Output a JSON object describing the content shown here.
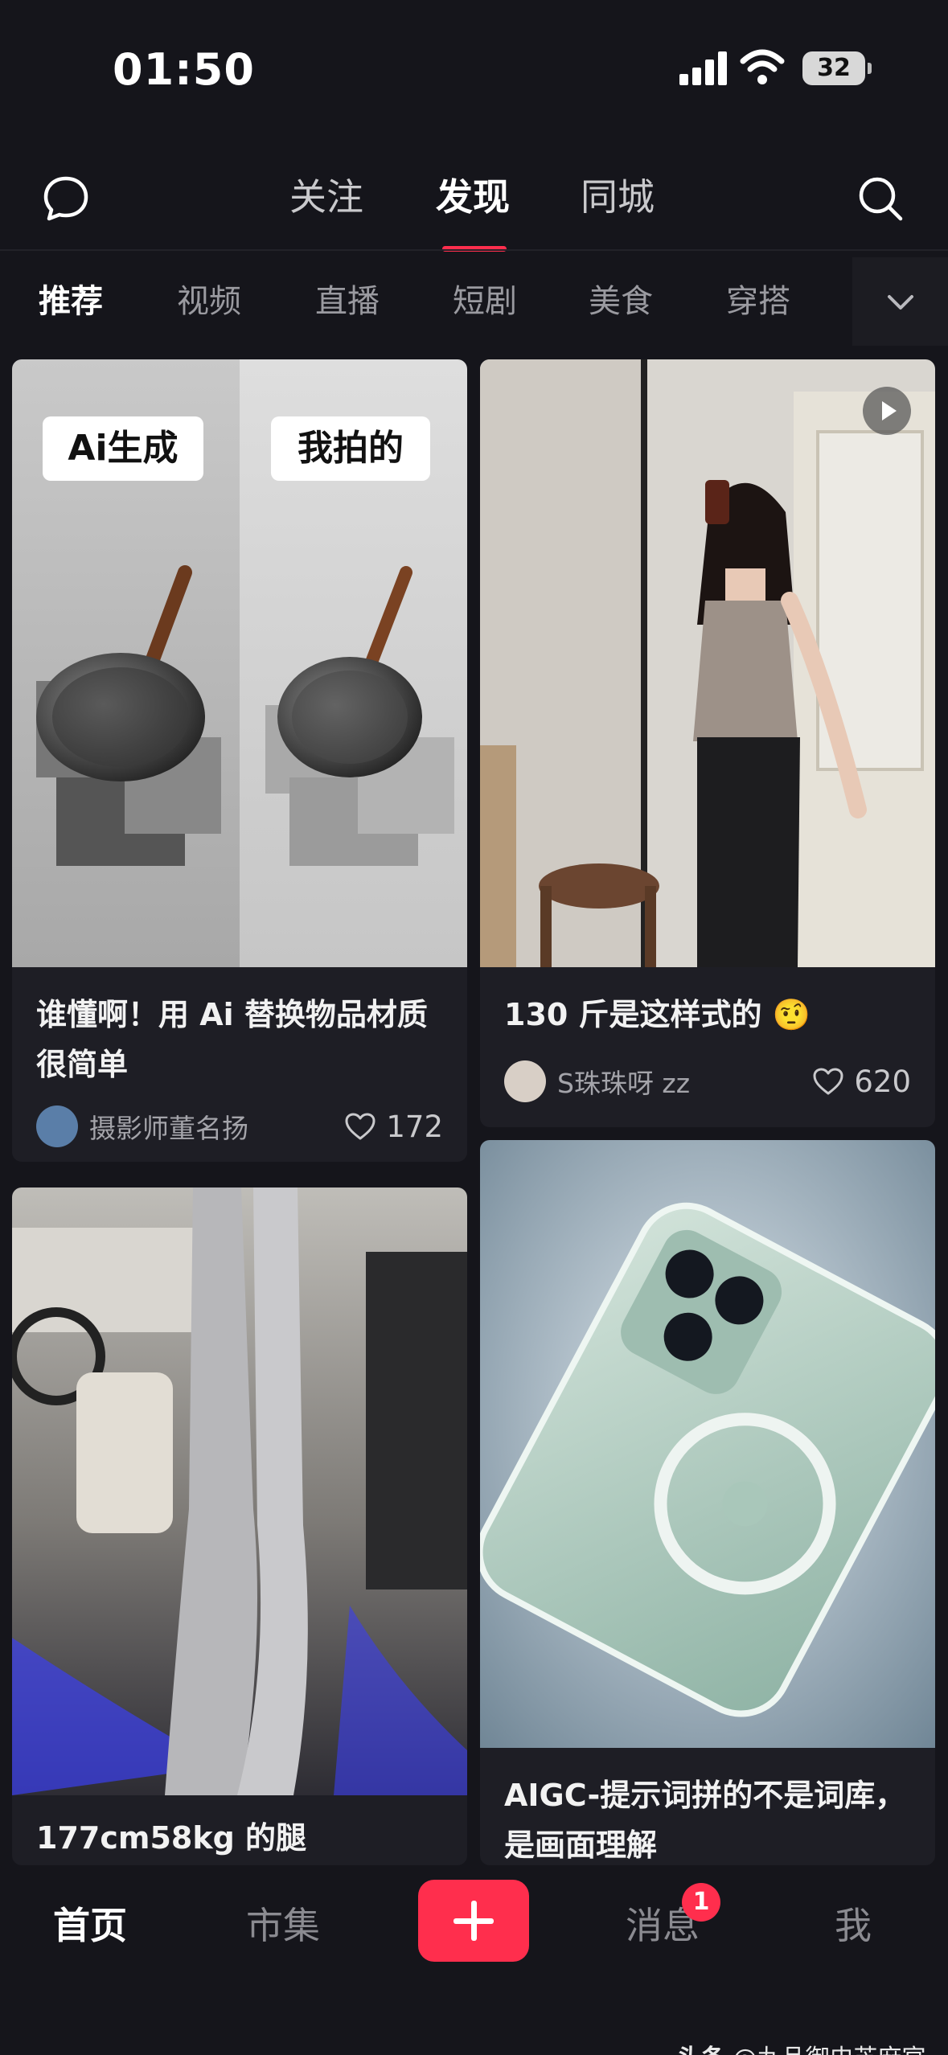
{
  "status_bar": {
    "time": "01:50",
    "battery": "32"
  },
  "top_nav": {
    "tabs": [
      {
        "label": "关注"
      },
      {
        "label": "发现"
      },
      {
        "label": "同城"
      }
    ],
    "active_tab": "发现",
    "accent": "#ff2e4d"
  },
  "categories": [
    "推荐",
    "视频",
    "直播",
    "短剧",
    "美食",
    "穿搭"
  ],
  "feed": [
    {
      "labels": [
        "Ai生成",
        "我拍的"
      ],
      "title": "谁懂啊！用 Ai 替换物品材质很简单",
      "author": "摄影师董名扬",
      "likes": "172"
    },
    {
      "title": "130 斤是这样式的 🤨",
      "author": "S珠珠呀 zz",
      "likes": "620",
      "is_video": true
    },
    {
      "title": "177cm58kg 的腿"
    },
    {
      "title": "AIGC-提示词拼的不是词库，是画面理解"
    }
  ],
  "bottom_nav": [
    {
      "label": "首页"
    },
    {
      "label": "市集"
    },
    {
      "label": "消息",
      "badge": "1"
    },
    {
      "label": "我"
    }
  ],
  "watermark": {
    "prefix": "头条",
    "handle": "@九品御史芝麻官"
  },
  "icons": [
    "chat-bubble-icon",
    "search-icon",
    "chevron-down-icon",
    "heart-icon",
    "play-icon",
    "plus-icon",
    "signal-icon",
    "wifi-icon",
    "battery-icon"
  ]
}
